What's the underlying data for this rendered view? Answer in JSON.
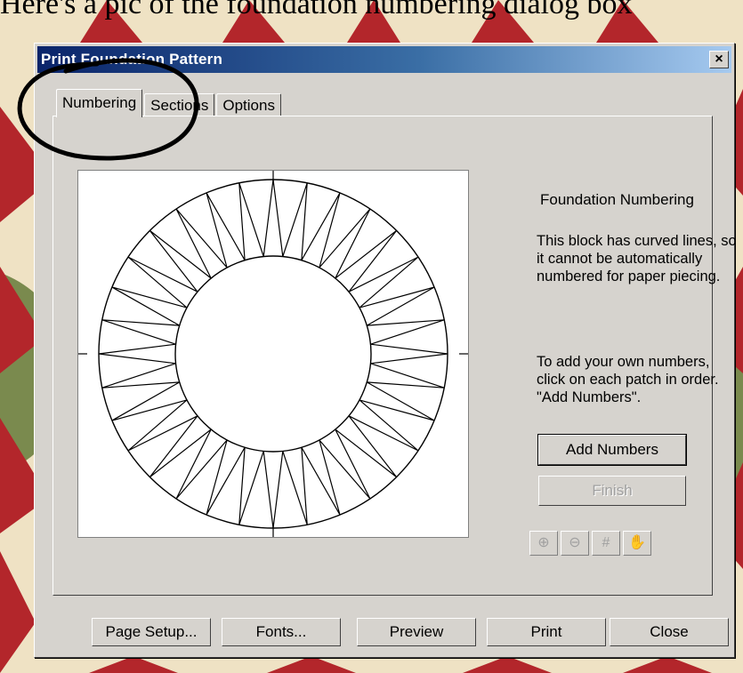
{
  "caption": "Here's a pic of the foundation numbering dialog box",
  "dialog": {
    "title": "Print Foundation Pattern",
    "close_label": "×",
    "tabs": [
      {
        "label": "Numbering",
        "active": true
      },
      {
        "label": "Sections",
        "active": false
      },
      {
        "label": "Options",
        "active": false
      }
    ]
  },
  "panel": {
    "heading": "Foundation Numbering",
    "para1": "This block has curved lines, so it cannot be automatically numbered for paper piecing.",
    "para2": "To add your own numbers, click on each patch in order. \"Add Numbers\".",
    "add_numbers": "Add Numbers",
    "finish": "Finish",
    "tools": [
      {
        "name": "zoom-in-icon",
        "glyph": "⊕"
      },
      {
        "name": "zoom-out-icon",
        "glyph": "⊖"
      },
      {
        "name": "grid-icon",
        "glyph": "#"
      },
      {
        "name": "hand-icon",
        "glyph": "✋"
      }
    ]
  },
  "footer": {
    "page_setup": "Page Setup...",
    "fonts": "Fonts...",
    "preview": "Preview",
    "print": "Print",
    "close": "Close"
  },
  "colors": {
    "dialog_bg": "#d6d3ce",
    "title_start": "#0a246a",
    "title_end": "#a6caf0",
    "quilt_red": "#b3262b",
    "quilt_cream": "#efe2c4",
    "quilt_green": "#7a8a4e"
  }
}
